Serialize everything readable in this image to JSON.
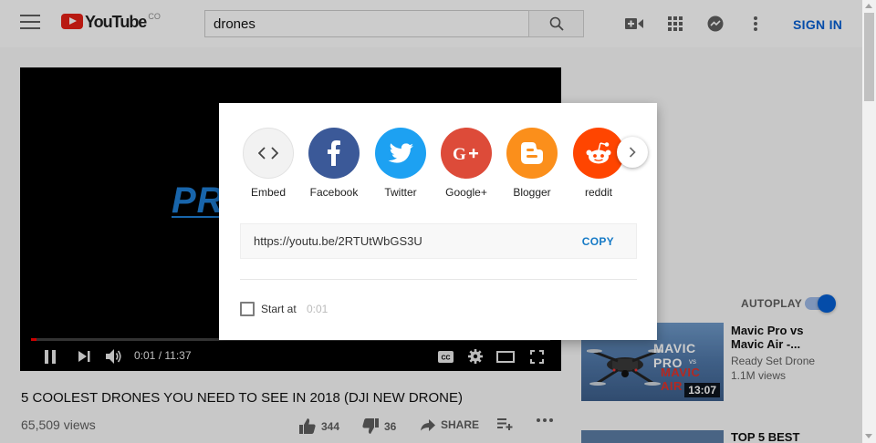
{
  "header": {
    "logo_text": "YouTube",
    "logo_region": "CO",
    "search_value": "drones",
    "signin_label": "SIGN IN"
  },
  "player": {
    "video_logo_text": "PR",
    "time": "0:01 / 11:37",
    "progress_fraction": 0.0014
  },
  "video": {
    "title": "5 COOLEST DRONES YOU NEED TO SEE IN 2018 (DJI NEW DRONE)",
    "views": "65,509 views",
    "likes": "344",
    "dislikes": "36",
    "share_label": "SHARE"
  },
  "share_dialog": {
    "targets": [
      {
        "label": "Embed",
        "icon": "embed-icon",
        "color": "#f2f2f2"
      },
      {
        "label": "Facebook",
        "icon": "facebook-icon",
        "color": "#3b5998"
      },
      {
        "label": "Twitter",
        "icon": "twitter-icon",
        "color": "#1da1f2"
      },
      {
        "label": "Google+",
        "icon": "google-plus-icon",
        "color": "#dd4b39"
      },
      {
        "label": "Blogger",
        "icon": "blogger-icon",
        "color": "#fb8f1b"
      },
      {
        "label": "reddit",
        "icon": "reddit-icon",
        "color": "#ff4500"
      }
    ],
    "url": "https://youtu.be/2RTUtWbGS3U",
    "copy_label": "COPY",
    "start_at_label": "Start at",
    "start_at_time": "0:01",
    "start_at_checked": false
  },
  "sidebar": {
    "autoplay_label": "AUTOPLAY",
    "autoplay_on": true,
    "recommendations": [
      {
        "title": "Mavic Pro vs Mavic Air -...",
        "channel": "Ready Set Drone",
        "views": "1.1M views",
        "duration": "13:07",
        "thumb_text_1": "MAVIC PRO",
        "thumb_vs": "vs",
        "thumb_text_2": "MAVIC AIR"
      },
      {
        "title": "TOP 5 BEST"
      }
    ]
  }
}
